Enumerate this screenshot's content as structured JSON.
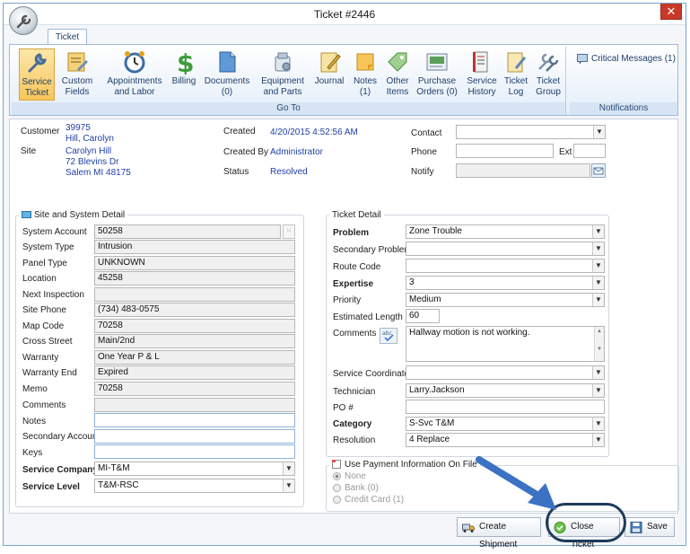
{
  "window": {
    "title": "Ticket #2446",
    "close_glyph": "✕"
  },
  "ribbon": {
    "tab": "Ticket",
    "goto_caption": "Go To",
    "notifications_caption": "Notifications",
    "critical_messages": "Critical Messages (1)",
    "buttons": [
      {
        "l1": "Service",
        "l2": "Ticket",
        "icon": "wrench-icon"
      },
      {
        "l1": "Custom",
        "l2": "Fields",
        "icon": "form-edit-icon"
      },
      {
        "l1": "Appointments",
        "l2": "and Labor",
        "icon": "alarm-clock-icon"
      },
      {
        "l1": "Billing",
        "l2": "",
        "icon": "dollar-icon"
      },
      {
        "l1": "Documents",
        "l2": "(0)",
        "icon": "document-icon"
      },
      {
        "l1": "Equipment",
        "l2": "and Parts",
        "icon": "equipment-icon"
      },
      {
        "l1": "Journal",
        "l2": "",
        "icon": "journal-icon"
      },
      {
        "l1": "Notes",
        "l2": "(1)",
        "icon": "notes-icon"
      },
      {
        "l1": "Other",
        "l2": "Items",
        "icon": "tag-icon"
      },
      {
        "l1": "Purchase",
        "l2": "Orders (0)",
        "icon": "purchase-order-icon"
      },
      {
        "l1": "Service",
        "l2": "History",
        "icon": "service-history-icon"
      },
      {
        "l1": "Ticket",
        "l2": "Log",
        "icon": "ticket-log-icon"
      },
      {
        "l1": "Ticket",
        "l2": "Group",
        "icon": "ticket-group-icon"
      }
    ]
  },
  "header": {
    "customer_label": "Customer",
    "customer_number": "39975",
    "customer_name": "Hill, Carolyn",
    "site_label": "Site",
    "site_name": "Carolyn Hill",
    "site_address1": "72 Blevins Dr",
    "site_address2": "Salem MI 48175",
    "created_label": "Created",
    "created_value": "4/20/2015 4:52:56 AM",
    "created_by_label": "Created By",
    "created_by_value": "Administrator",
    "status_label": "Status",
    "status_value": "Resolved",
    "contact_label": "Contact",
    "phone_label": "Phone",
    "ext_label": "Ext",
    "notify_label": "Notify"
  },
  "site_detail": {
    "title": "Site and System Detail",
    "fields": [
      {
        "label": "System Account",
        "value": "50258"
      },
      {
        "label": "System Type",
        "value": "Intrusion"
      },
      {
        "label": "Panel Type",
        "value": "UNKNOWN"
      },
      {
        "label": "Location",
        "value": "45258"
      },
      {
        "label": "Next Inspection",
        "value": ""
      },
      {
        "label": "Site Phone",
        "value": "(734) 483-0575"
      },
      {
        "label": "Map Code",
        "value": "70258"
      },
      {
        "label": "Cross Street",
        "value": "Main/2nd"
      },
      {
        "label": "Warranty",
        "value": "One Year P & L"
      },
      {
        "label": "Warranty End",
        "value": "Expired"
      },
      {
        "label": "Memo",
        "value": "70258"
      },
      {
        "label": "Comments",
        "value": ""
      },
      {
        "label": "Notes",
        "value": ""
      },
      {
        "label": "Secondary Account",
        "value": ""
      },
      {
        "label": "Keys",
        "value": ""
      }
    ],
    "service_company_label": "Service Company",
    "service_company_value": "MI-T&M",
    "service_level_label": "Service Level",
    "service_level_value": "T&M-RSC"
  },
  "ticket_detail": {
    "title": "Ticket Detail",
    "problem_label": "Problem",
    "problem_value": "Zone Trouble",
    "secondary_problem_label": "Secondary Problem",
    "secondary_problem_value": "",
    "route_code_label": "Route Code",
    "route_code_value": "",
    "expertise_label": "Expertise",
    "expertise_value": "3",
    "priority_label": "Priority",
    "priority_value": "Medium",
    "estimated_length_label": "Estimated Length",
    "estimated_length_value": "60",
    "comments_label": "Comments",
    "comments_value": "Hallway motion is not working.",
    "service_coordinator_label": "Service Coordinator",
    "service_coordinator_value": "",
    "technician_label": "Technician",
    "technician_value": "Larry.Jackson",
    "po_label": "PO #",
    "po_value": "",
    "category_label": "Category",
    "category_value": "S-Svc T&M",
    "resolution_label": "Resolution",
    "resolution_value": "4 Replace"
  },
  "payment": {
    "title": "Use Payment Information On File",
    "options": [
      "None",
      "Bank (0)",
      "Credit Card (1)"
    ]
  },
  "actions": {
    "create_shipment": "Create Shipment",
    "close_ticket": "Close Ticket",
    "save": "Save"
  },
  "colors": {
    "accent": "#3a78c9",
    "value_text": "#1f3fa8",
    "active_button": "#f7c65a"
  }
}
